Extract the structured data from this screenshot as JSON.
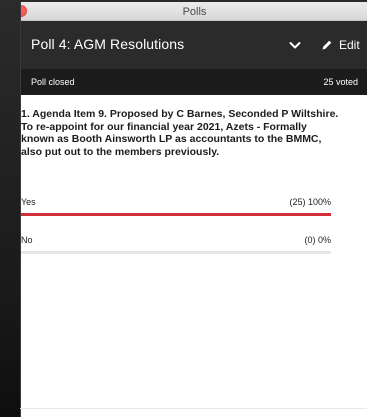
{
  "window": {
    "title": "Polls"
  },
  "header": {
    "poll_title": "Poll 4: AGM Resolutions",
    "edit_label": "Edit",
    "background": "#2b2b2b"
  },
  "status": {
    "state": "Poll closed",
    "votes": "25 voted"
  },
  "question": {
    "line1": "1. Agenda Item 9. Proposed by C Barnes, Seconded P Wiltshire.",
    "line2": "To re-appoint for our financial year 2021, Azets - Formally known as Booth Ainsworth LP as accountants to the BMMC, also put out to the members previously."
  },
  "options": [
    {
      "label": "Yes",
      "result": "(25) 100%",
      "fraction": 1.0,
      "color": "#d22f3b"
    },
    {
      "label": "No",
      "result": "(0) 0%",
      "fraction": 0.0,
      "color": "#d22f3b"
    }
  ],
  "icons": {
    "close": "close-dot",
    "expand": "chevron-down-icon",
    "edit": "pencil-icon"
  }
}
